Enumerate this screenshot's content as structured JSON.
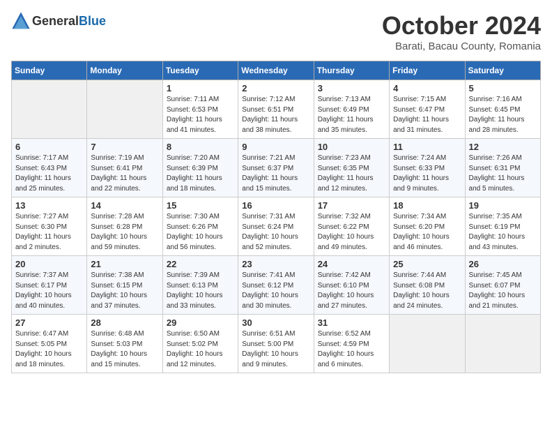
{
  "header": {
    "logo_general": "General",
    "logo_blue": "Blue",
    "month": "October 2024",
    "location": "Barati, Bacau County, Romania"
  },
  "weekdays": [
    "Sunday",
    "Monday",
    "Tuesday",
    "Wednesday",
    "Thursday",
    "Friday",
    "Saturday"
  ],
  "weeks": [
    [
      {
        "day": "",
        "empty": true
      },
      {
        "day": "",
        "empty": true
      },
      {
        "day": "1",
        "sunrise": "Sunrise: 7:11 AM",
        "sunset": "Sunset: 6:53 PM",
        "daylight": "Daylight: 11 hours and 41 minutes."
      },
      {
        "day": "2",
        "sunrise": "Sunrise: 7:12 AM",
        "sunset": "Sunset: 6:51 PM",
        "daylight": "Daylight: 11 hours and 38 minutes."
      },
      {
        "day": "3",
        "sunrise": "Sunrise: 7:13 AM",
        "sunset": "Sunset: 6:49 PM",
        "daylight": "Daylight: 11 hours and 35 minutes."
      },
      {
        "day": "4",
        "sunrise": "Sunrise: 7:15 AM",
        "sunset": "Sunset: 6:47 PM",
        "daylight": "Daylight: 11 hours and 31 minutes."
      },
      {
        "day": "5",
        "sunrise": "Sunrise: 7:16 AM",
        "sunset": "Sunset: 6:45 PM",
        "daylight": "Daylight: 11 hours and 28 minutes."
      }
    ],
    [
      {
        "day": "6",
        "sunrise": "Sunrise: 7:17 AM",
        "sunset": "Sunset: 6:43 PM",
        "daylight": "Daylight: 11 hours and 25 minutes."
      },
      {
        "day": "7",
        "sunrise": "Sunrise: 7:19 AM",
        "sunset": "Sunset: 6:41 PM",
        "daylight": "Daylight: 11 hours and 22 minutes."
      },
      {
        "day": "8",
        "sunrise": "Sunrise: 7:20 AM",
        "sunset": "Sunset: 6:39 PM",
        "daylight": "Daylight: 11 hours and 18 minutes."
      },
      {
        "day": "9",
        "sunrise": "Sunrise: 7:21 AM",
        "sunset": "Sunset: 6:37 PM",
        "daylight": "Daylight: 11 hours and 15 minutes."
      },
      {
        "day": "10",
        "sunrise": "Sunrise: 7:23 AM",
        "sunset": "Sunset: 6:35 PM",
        "daylight": "Daylight: 11 hours and 12 minutes."
      },
      {
        "day": "11",
        "sunrise": "Sunrise: 7:24 AM",
        "sunset": "Sunset: 6:33 PM",
        "daylight": "Daylight: 11 hours and 9 minutes."
      },
      {
        "day": "12",
        "sunrise": "Sunrise: 7:26 AM",
        "sunset": "Sunset: 6:31 PM",
        "daylight": "Daylight: 11 hours and 5 minutes."
      }
    ],
    [
      {
        "day": "13",
        "sunrise": "Sunrise: 7:27 AM",
        "sunset": "Sunset: 6:30 PM",
        "daylight": "Daylight: 11 hours and 2 minutes."
      },
      {
        "day": "14",
        "sunrise": "Sunrise: 7:28 AM",
        "sunset": "Sunset: 6:28 PM",
        "daylight": "Daylight: 10 hours and 59 minutes."
      },
      {
        "day": "15",
        "sunrise": "Sunrise: 7:30 AM",
        "sunset": "Sunset: 6:26 PM",
        "daylight": "Daylight: 10 hours and 56 minutes."
      },
      {
        "day": "16",
        "sunrise": "Sunrise: 7:31 AM",
        "sunset": "Sunset: 6:24 PM",
        "daylight": "Daylight: 10 hours and 52 minutes."
      },
      {
        "day": "17",
        "sunrise": "Sunrise: 7:32 AM",
        "sunset": "Sunset: 6:22 PM",
        "daylight": "Daylight: 10 hours and 49 minutes."
      },
      {
        "day": "18",
        "sunrise": "Sunrise: 7:34 AM",
        "sunset": "Sunset: 6:20 PM",
        "daylight": "Daylight: 10 hours and 46 minutes."
      },
      {
        "day": "19",
        "sunrise": "Sunrise: 7:35 AM",
        "sunset": "Sunset: 6:19 PM",
        "daylight": "Daylight: 10 hours and 43 minutes."
      }
    ],
    [
      {
        "day": "20",
        "sunrise": "Sunrise: 7:37 AM",
        "sunset": "Sunset: 6:17 PM",
        "daylight": "Daylight: 10 hours and 40 minutes."
      },
      {
        "day": "21",
        "sunrise": "Sunrise: 7:38 AM",
        "sunset": "Sunset: 6:15 PM",
        "daylight": "Daylight: 10 hours and 37 minutes."
      },
      {
        "day": "22",
        "sunrise": "Sunrise: 7:39 AM",
        "sunset": "Sunset: 6:13 PM",
        "daylight": "Daylight: 10 hours and 33 minutes."
      },
      {
        "day": "23",
        "sunrise": "Sunrise: 7:41 AM",
        "sunset": "Sunset: 6:12 PM",
        "daylight": "Daylight: 10 hours and 30 minutes."
      },
      {
        "day": "24",
        "sunrise": "Sunrise: 7:42 AM",
        "sunset": "Sunset: 6:10 PM",
        "daylight": "Daylight: 10 hours and 27 minutes."
      },
      {
        "day": "25",
        "sunrise": "Sunrise: 7:44 AM",
        "sunset": "Sunset: 6:08 PM",
        "daylight": "Daylight: 10 hours and 24 minutes."
      },
      {
        "day": "26",
        "sunrise": "Sunrise: 7:45 AM",
        "sunset": "Sunset: 6:07 PM",
        "daylight": "Daylight: 10 hours and 21 minutes."
      }
    ],
    [
      {
        "day": "27",
        "sunrise": "Sunrise: 6:47 AM",
        "sunset": "Sunset: 5:05 PM",
        "daylight": "Daylight: 10 hours and 18 minutes."
      },
      {
        "day": "28",
        "sunrise": "Sunrise: 6:48 AM",
        "sunset": "Sunset: 5:03 PM",
        "daylight": "Daylight: 10 hours and 15 minutes."
      },
      {
        "day": "29",
        "sunrise": "Sunrise: 6:50 AM",
        "sunset": "Sunset: 5:02 PM",
        "daylight": "Daylight: 10 hours and 12 minutes."
      },
      {
        "day": "30",
        "sunrise": "Sunrise: 6:51 AM",
        "sunset": "Sunset: 5:00 PM",
        "daylight": "Daylight: 10 hours and 9 minutes."
      },
      {
        "day": "31",
        "sunrise": "Sunrise: 6:52 AM",
        "sunset": "Sunset: 4:59 PM",
        "daylight": "Daylight: 10 hours and 6 minutes."
      },
      {
        "day": "",
        "empty": true
      },
      {
        "day": "",
        "empty": true
      }
    ]
  ]
}
